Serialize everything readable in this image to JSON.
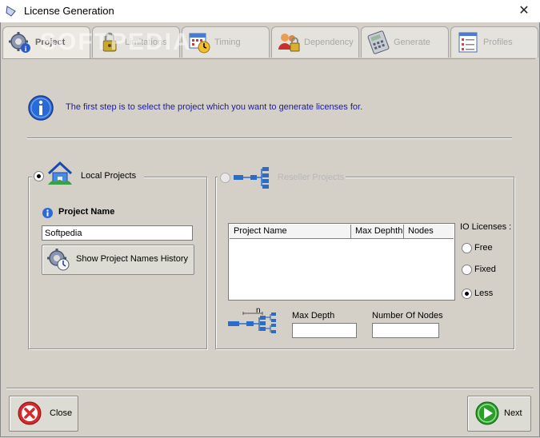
{
  "window": {
    "title": "License Generation",
    "close_glyph": "✕"
  },
  "watermark": "SOFTPEDIA",
  "tabs": [
    {
      "label": "Project",
      "icon": "gear-info-icon",
      "active": true
    },
    {
      "label": "Limitations",
      "icon": "lock-icon",
      "active": false
    },
    {
      "label": "Timing",
      "icon": "calendar-clock-icon",
      "active": false
    },
    {
      "label": "Dependency",
      "icon": "users-lock-icon",
      "active": false
    },
    {
      "label": "Generate",
      "icon": "calculator-icon",
      "active": false
    },
    {
      "label": "Profiles",
      "icon": "form-list-icon",
      "active": false
    }
  ],
  "info": {
    "text": "The first step is to select the project which you want to generate licenses for."
  },
  "local": {
    "label": "Local Projects",
    "selected": true,
    "project_name_label": "Project Name",
    "project_name_value": "Softpedia",
    "history_button": "Show Project Names History"
  },
  "reseller": {
    "label": "Reseller Projects",
    "selected": false,
    "table_headers": [
      "Project Name",
      "Max Dephth",
      "Nodes"
    ],
    "licenses_label": "IO Licenses :",
    "license_options": [
      {
        "label": "Free",
        "selected": false
      },
      {
        "label": "Fixed",
        "selected": false
      },
      {
        "label": "Less",
        "selected": true
      }
    ],
    "tree_n_label": "n",
    "max_depth_label": "Max Depth",
    "nodes_label": "Number Of Nodes",
    "max_depth_value": "",
    "nodes_value": ""
  },
  "footer": {
    "close_label": "Close",
    "next_label": "Next"
  },
  "colors": {
    "info_text": "#1a1aa0",
    "close_red": "#d9282c",
    "next_green": "#2aa02a",
    "tree_blue": "#2a6cc8"
  }
}
